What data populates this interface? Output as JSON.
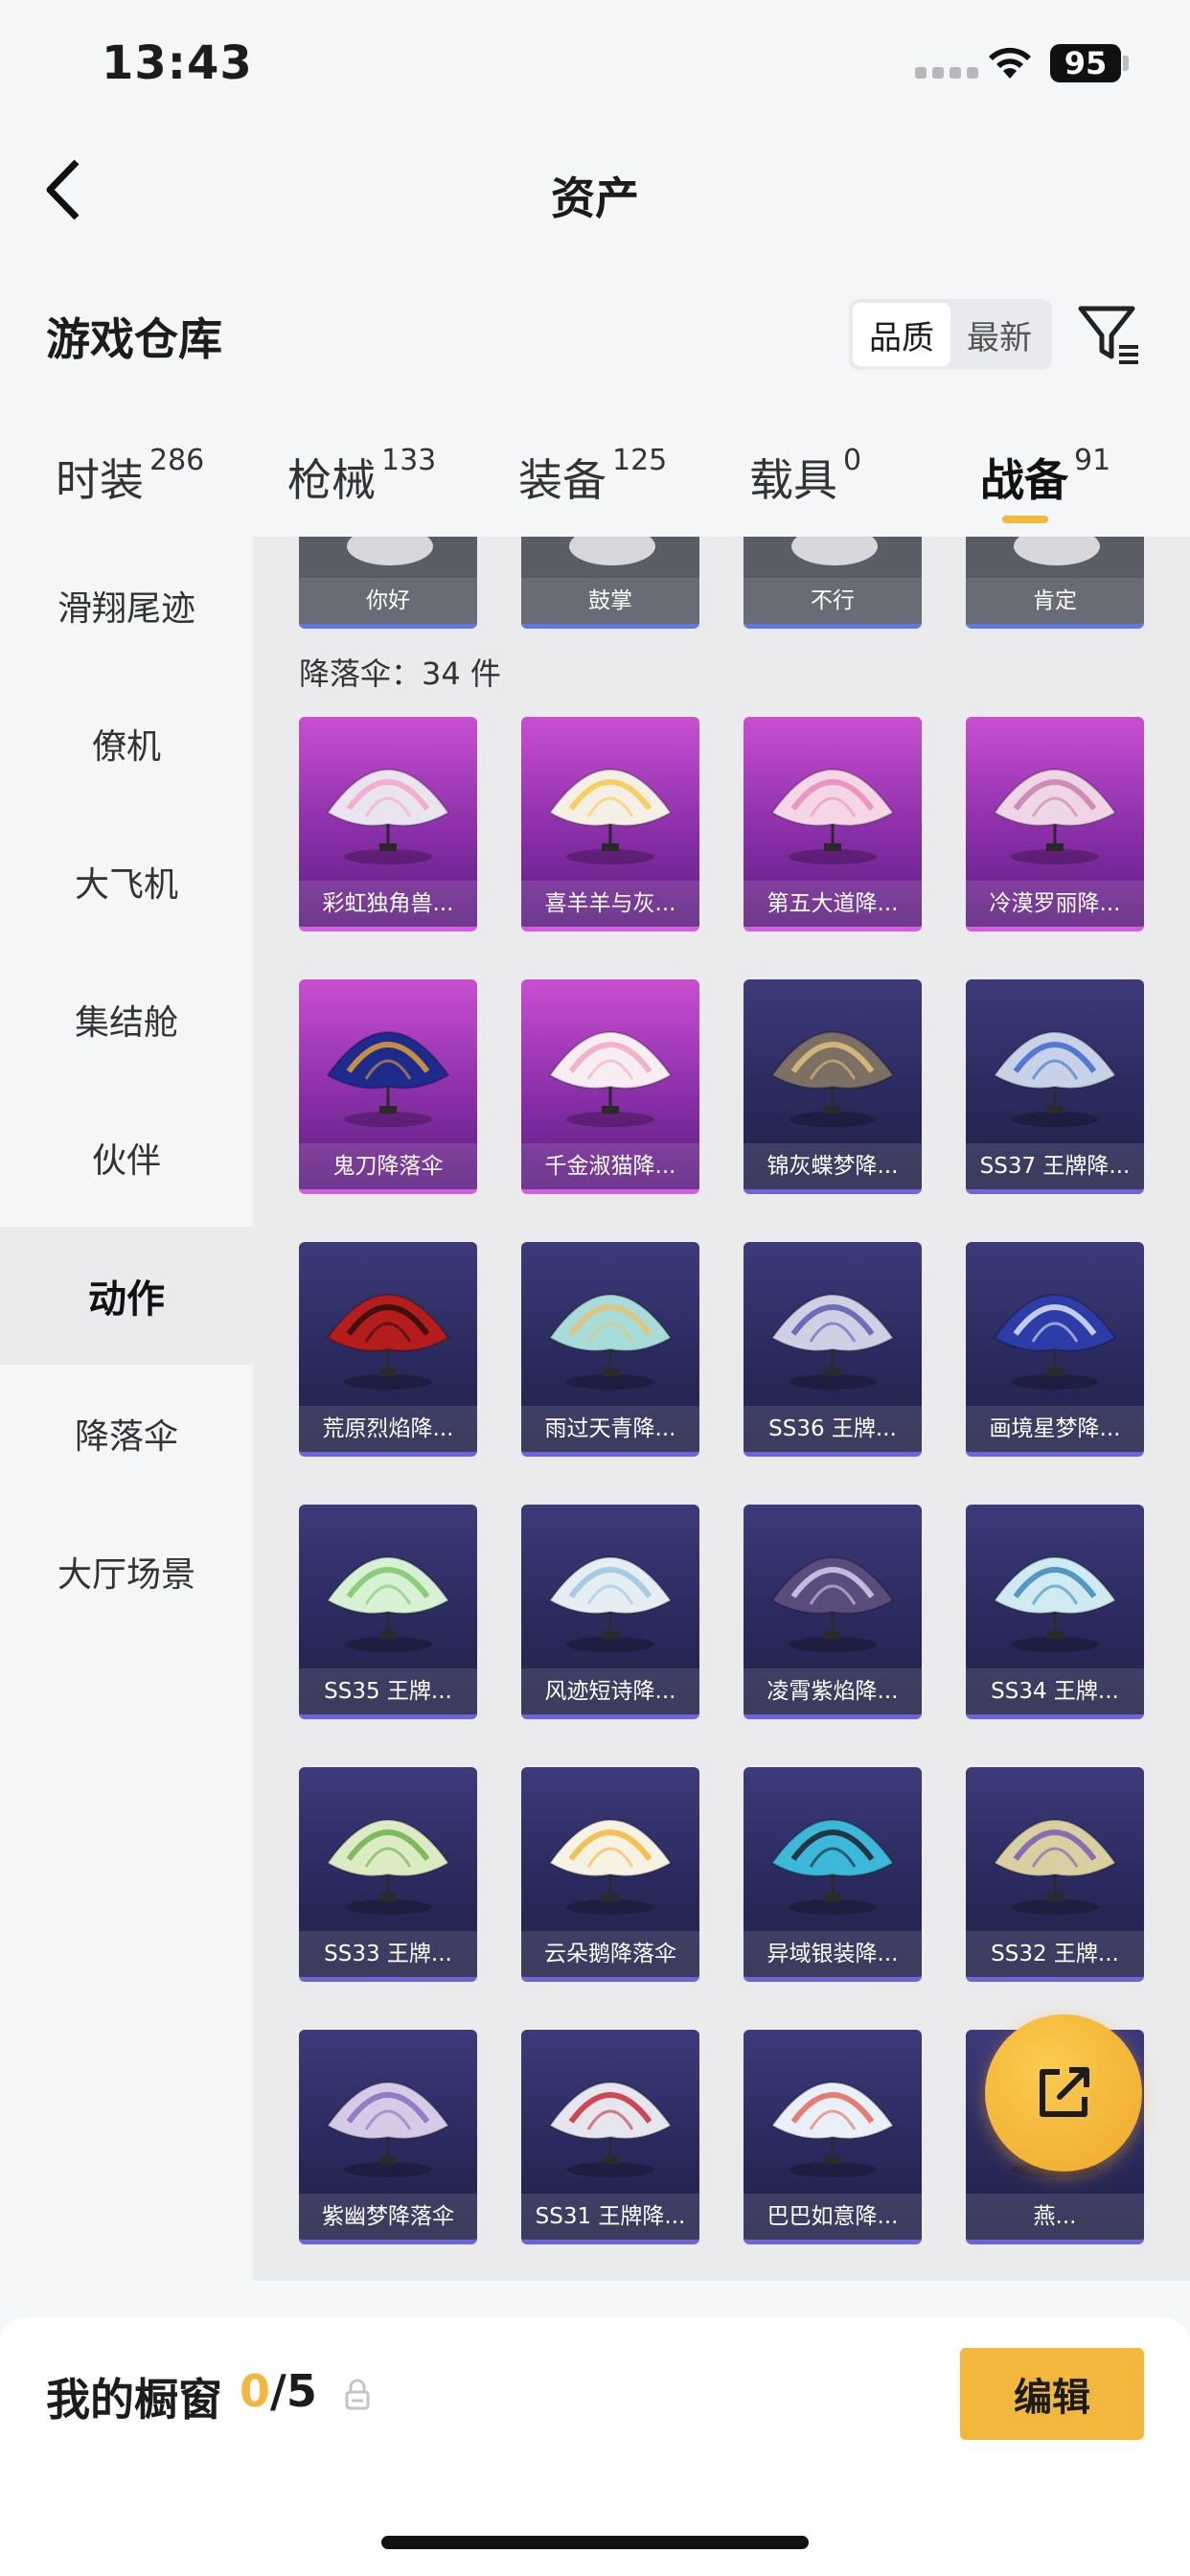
{
  "status_bar": {
    "time": "13:43",
    "battery": "95"
  },
  "nav": {
    "title": "资产"
  },
  "warehouse": {
    "title": "游戏仓库",
    "sort_options": [
      "品质",
      "最新"
    ],
    "active_sort": "品质"
  },
  "tabs": [
    {
      "label": "时装",
      "count": "286"
    },
    {
      "label": "枪械",
      "count": "133"
    },
    {
      "label": "装备",
      "count": "125"
    },
    {
      "label": "载具",
      "count": "0"
    },
    {
      "label": "战备",
      "count": "91",
      "active": true
    }
  ],
  "sidebar": {
    "items": [
      "滑翔尾迹",
      "僚机",
      "大飞机",
      "集结舱",
      "伙伴",
      "动作",
      "降落伞",
      "大厅场景"
    ],
    "active": "动作"
  },
  "actions_row": [
    "你好",
    "鼓掌",
    "不行",
    "肯定"
  ],
  "parachute_section": {
    "title": "降落伞：34 件"
  },
  "parachutes": [
    {
      "name": "彩虹独角兽...",
      "tier": "gold",
      "color": "#e8e4f0",
      "accent": "#f3a6c8"
    },
    {
      "name": "喜羊羊与灰...",
      "tier": "gold",
      "color": "#f5f0e6",
      "accent": "#f6c94a"
    },
    {
      "name": "第五大道降...",
      "tier": "gold",
      "color": "#f4d6e6",
      "accent": "#e98ab9"
    },
    {
      "name": "冷漠罗丽降...",
      "tier": "gold",
      "color": "#efd6e6",
      "accent": "#c87fae"
    },
    {
      "name": "鬼刀降落伞",
      "tier": "gold",
      "color": "#1e2a8c",
      "accent": "#e0a030"
    },
    {
      "name": "千金淑猫降...",
      "tier": "gold",
      "color": "#f6eef2",
      "accent": "#f2a7c3"
    },
    {
      "name": "锦灰蝶梦降...",
      "tier": "blue",
      "color": "#7c7064",
      "accent": "#e0c27a"
    },
    {
      "name": "SS37 王牌降...",
      "tier": "blue",
      "color": "#c8d2e6",
      "accent": "#3c6ad0"
    },
    {
      "name": "荒原烈焰降...",
      "tier": "blue",
      "color": "#b51c1c",
      "accent": "#2a1010"
    },
    {
      "name": "雨过天青降...",
      "tier": "blue",
      "color": "#a8dcd8",
      "accent": "#e6c272"
    },
    {
      "name": "SS36 王牌...",
      "tier": "blue",
      "color": "#cfd0e4",
      "accent": "#5a5ab0"
    },
    {
      "name": "画境星梦降...",
      "tier": "blue",
      "color": "#2c3da8",
      "accent": "#dfe4f4"
    },
    {
      "name": "SS35 王牌...",
      "tier": "blue",
      "color": "#d8f0d4",
      "accent": "#7cc86a"
    },
    {
      "name": "风迹短诗降...",
      "tier": "blue",
      "color": "#e6eef2",
      "accent": "#9ac6de"
    },
    {
      "name": "凌霄紫焰降...",
      "tier": "blue",
      "color": "#5a4c7c",
      "accent": "#d8ccf0"
    },
    {
      "name": "SS34 王牌...",
      "tier": "blue",
      "color": "#cfeaf0",
      "accent": "#3c8ab8"
    },
    {
      "name": "SS33 王牌...",
      "tier": "blue",
      "color": "#dcebc4",
      "accent": "#6db04a"
    },
    {
      "name": "云朵鹅降落伞",
      "tier": "blue",
      "color": "#f6f2e4",
      "accent": "#f2b73c"
    },
    {
      "name": "异域银装降...",
      "tier": "blue",
      "color": "#3cb8d8",
      "accent": "#1e1e2a"
    },
    {
      "name": "SS32 王牌...",
      "tier": "blue",
      "color": "#d8d0a0",
      "accent": "#7a5ab8"
    },
    {
      "name": "紫幽梦降落伞",
      "tier": "blue",
      "color": "#d6cbe6",
      "accent": "#8a6cc0"
    },
    {
      "name": "SS31 王牌降...",
      "tier": "blue",
      "color": "#e6e6ee",
      "accent": "#c82a3a"
    },
    {
      "name": "巴巴如意降...",
      "tier": "blue",
      "color": "#eaf0f8",
      "accent": "#e46a5a"
    },
    {
      "name": "燕...",
      "tier": "blue",
      "color": "#3a3a6a",
      "accent": "#5a5a8a"
    }
  ],
  "showcase": {
    "label": "我的橱窗",
    "current": "0",
    "max": "/5",
    "edit_label": "编辑"
  },
  "colors": {
    "accent": "#f2b73c",
    "gold_tier": "#c84fd0",
    "blue_tier": "#3d3a7a"
  }
}
